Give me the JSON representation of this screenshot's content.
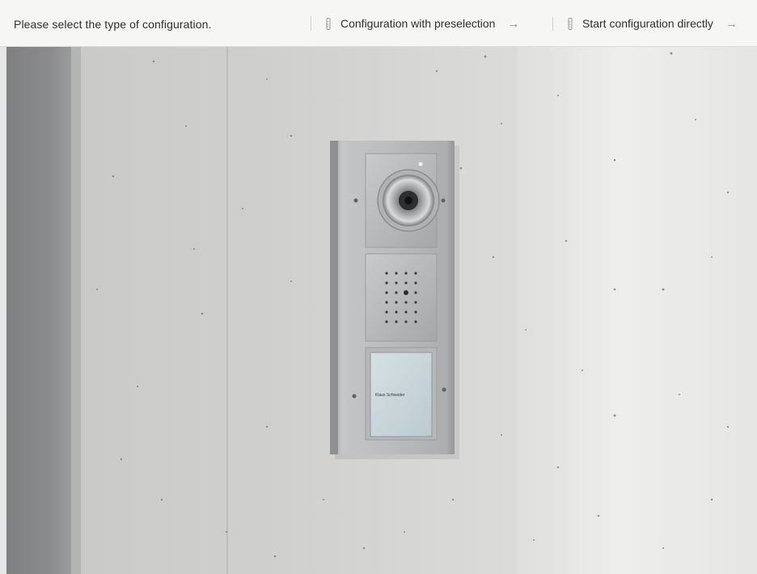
{
  "topbar": {
    "prompt": "Please select the type of configuration.",
    "options": [
      {
        "label": "Configuration with preselection",
        "icon": "ruler-icon",
        "arrow": "→"
      },
      {
        "label": "Start configuration directly",
        "icon": "ruler-icon",
        "arrow": "→"
      }
    ]
  },
  "photo": {
    "subject": "door-intercom-station-icon",
    "nameplate_text": "Klaus Schneider"
  }
}
